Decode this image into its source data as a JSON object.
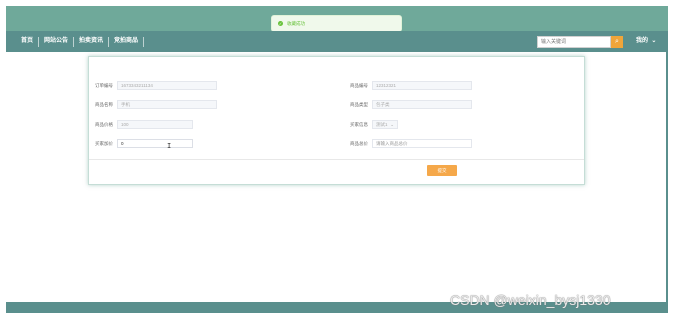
{
  "toast": {
    "text": "收藏成功",
    "icon": "check-circle-icon"
  },
  "nav": {
    "items": [
      {
        "label": "首页"
      },
      {
        "label": "网站公告"
      },
      {
        "label": "拍卖资讯"
      },
      {
        "label": "竞拍商品"
      }
    ],
    "search_placeholder": "输入关键词",
    "search_icon": "search-icon",
    "user_label": "我的",
    "user_icon": "chevron-down-icon"
  },
  "form": {
    "order_no_label": "订单编号",
    "order_no_value": "1673343211134",
    "goods_no_label": "商品编号",
    "goods_no_value": "12312321",
    "goods_name_label": "商品名称",
    "goods_name_value": "手机",
    "goods_type_label": "商品类型",
    "goods_type_value": "包子类",
    "goods_price_label": "商品价格",
    "goods_price_value": "100",
    "buyer_info_label": "买家信息",
    "buyer_info_value": "测试1",
    "buyer_bid_label": "买家加价",
    "buyer_bid_value": "0",
    "total_price_label": "商品总价",
    "total_price_placeholder": "请输入商品总价",
    "submit_label": "提交"
  },
  "watermark": "CSDN @weixin_bysj1330",
  "colors": {
    "header": "#6fa99a",
    "nav": "#5a8f8d",
    "accent": "#f5a84a",
    "success": "#67c23a"
  }
}
